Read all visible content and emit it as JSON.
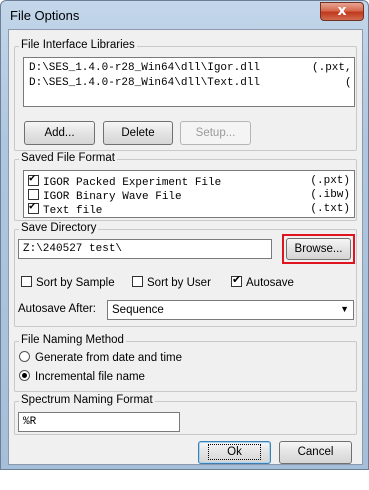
{
  "window": {
    "title": "File Options",
    "close_glyph": "x"
  },
  "libraries": {
    "legend": "File Interface Libraries",
    "items": [
      {
        "path": "D:\\SES_1.4.0-r28_Win64\\dll\\Igor.dll",
        "ext": "(.pxt,"
      },
      {
        "path": "D:\\SES_1.4.0-r28_Win64\\dll\\Text.dll",
        "ext": "("
      }
    ],
    "add_label": "Add...",
    "delete_label": "Delete",
    "setup_label": "Setup..."
  },
  "saved_format": {
    "legend": "Saved File Format",
    "items": [
      {
        "name": "IGOR Packed Experiment File",
        "ext": "(.pxt)",
        "checked": true
      },
      {
        "name": "IGOR Binary Wave File",
        "ext": "(.ibw)",
        "checked": false
      },
      {
        "name": "Text file",
        "ext": "(.txt)",
        "checked": true
      }
    ]
  },
  "save_directory": {
    "legend": "Save Directory",
    "value": "Z:\\240527 test\\",
    "browse_label": "Browse...",
    "sort_sample_label": "Sort by Sample",
    "sort_user_label": "Sort by User",
    "autosave_label": "Autosave",
    "sort_sample_checked": false,
    "sort_user_checked": false,
    "autosave_checked": true,
    "autosave_after_label": "Autosave After:",
    "autosave_after_value": "Sequence"
  },
  "naming": {
    "legend": "File Naming Method",
    "option_date": "Generate from date and time",
    "option_incremental": "Incremental file name",
    "selected": "incremental"
  },
  "spectrum": {
    "legend": "Spectrum Naming Format",
    "value": "%R"
  },
  "footer": {
    "ok_label": "Ok",
    "cancel_label": "Cancel"
  },
  "colors": {
    "highlight": "#e0141e",
    "close_button": "#c7432a"
  }
}
